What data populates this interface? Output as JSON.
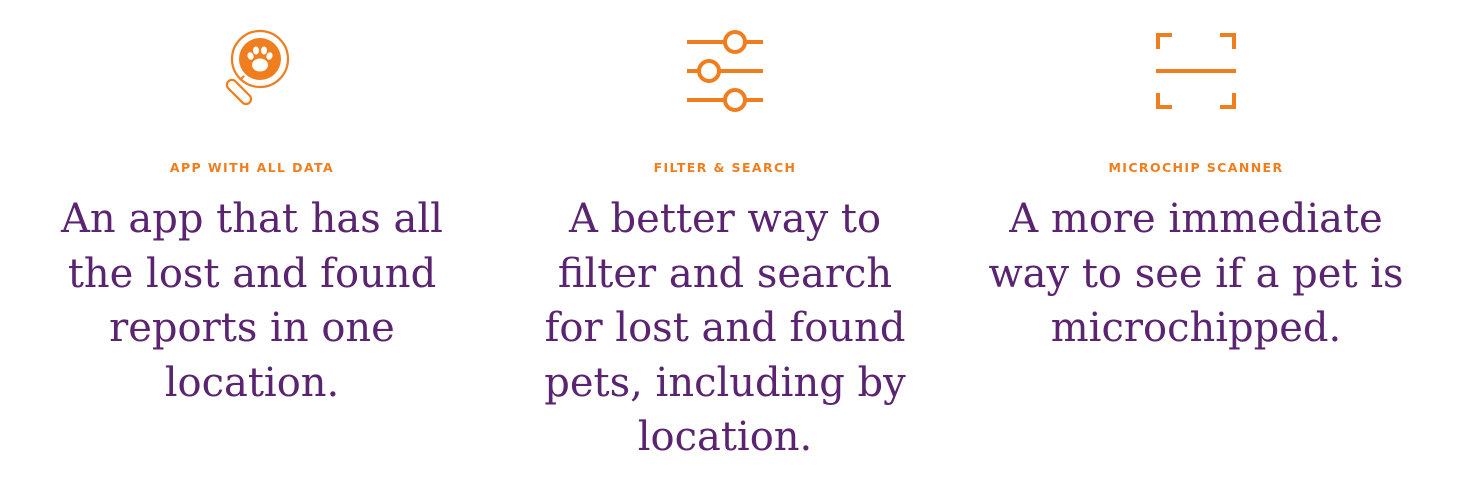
{
  "brand": {
    "accent_color": "#f07e1e",
    "text_color": "#5a2470"
  },
  "features": [
    {
      "icon": "magnifier-paw-icon",
      "label": "APP WITH ALL DATA",
      "description_lines": [
        "An app that has all",
        "the lost and found",
        "reports in one",
        "location."
      ]
    },
    {
      "icon": "sliders-icon",
      "label": "FILTER & SEARCH",
      "description_lines": [
        "A better way to",
        "filter and search",
        "for lost and found",
        "pets, including by",
        "location."
      ]
    },
    {
      "icon": "scanner-icon",
      "label": "MICROCHIP SCANNER",
      "description_lines": [
        "A more immediate",
        "way to see if a pet is",
        "microchipped."
      ]
    }
  ]
}
